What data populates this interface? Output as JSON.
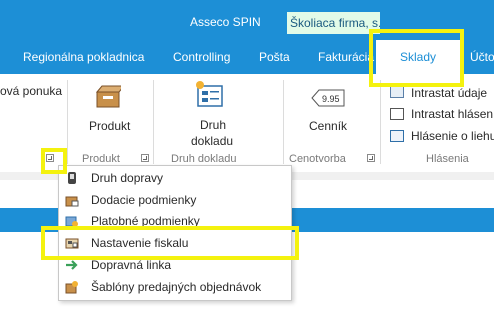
{
  "header": {
    "app_title": "Asseco SPIN",
    "company": "Školiaca firma, s.r.o."
  },
  "tabs": [
    {
      "label": "Regionálna pokladnica"
    },
    {
      "label": "Controlling"
    },
    {
      "label": "Pošta"
    },
    {
      "label": "Fakturácia"
    },
    {
      "label": "Sklady",
      "active": true
    },
    {
      "label": "Účtov"
    }
  ],
  "ribbon": {
    "offer_label": "ová ponuka",
    "product": {
      "label": "Produkt",
      "group": "Produkt"
    },
    "doc_type": {
      "label_line1": "Druh",
      "label_line2": "dokladu",
      "group": "Druh dokladu"
    },
    "pricelist": {
      "label": "Cenník",
      "icon_text": "9.95",
      "group": "Cenotvorba"
    },
    "reports": {
      "items": [
        {
          "label": "Intrastat údaje"
        },
        {
          "label": "Intrastat hlásen"
        },
        {
          "label": "Hlásenie o liehu"
        }
      ],
      "group": "Hlásenia"
    }
  },
  "menu": {
    "items": [
      {
        "label": "Druh dopravy",
        "icon": "phone-icon"
      },
      {
        "label": "Dodacie podmienky",
        "icon": "delivery-box-icon"
      },
      {
        "label": "Platobné podmienky",
        "icon": "payment-icon"
      },
      {
        "label": "Nastavenie fiskalu",
        "icon": "fiscal-register-icon"
      },
      {
        "label": "Dopravná linka",
        "icon": "arrow-right-icon"
      },
      {
        "label": "Šablóny predajných objednávok",
        "icon": "order-template-icon"
      }
    ]
  },
  "colors": {
    "accent": "#1d8fd6",
    "highlight": "#f4f20e",
    "company_bg": "#e2fbe8"
  }
}
